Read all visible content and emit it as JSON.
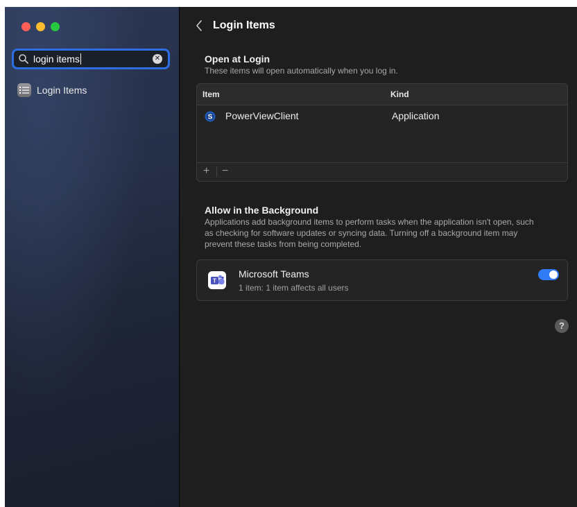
{
  "window": {
    "traffic_lights": [
      "close",
      "minimize",
      "zoom"
    ]
  },
  "sidebar": {
    "search": {
      "value": "login items",
      "icon": "magnifier-icon"
    },
    "results": [
      {
        "label": "Login Items",
        "icon": "list-icon"
      }
    ]
  },
  "header": {
    "title": "Login Items"
  },
  "open_at_login": {
    "title": "Open at Login",
    "description": "These items will open automatically when you log in.",
    "columns": [
      "Item",
      "Kind"
    ],
    "rows": [
      {
        "name": "PowerViewClient",
        "kind": "Application",
        "icon": "powerview-app-icon"
      }
    ],
    "add_label": "+",
    "remove_label": "−"
  },
  "background": {
    "title": "Allow in the Background",
    "description": "Applications add background items to perform tasks when the application isn't open, such as checking for software updates or syncing data. Turning off a background item may prevent these tasks from being completed.",
    "items": [
      {
        "name": "Microsoft Teams",
        "detail": "1 item: 1 item affects all users",
        "enabled": true,
        "icon": "microsoft-teams-icon"
      }
    ]
  },
  "help_label": "?",
  "colors": {
    "accent": "#2f7cf6",
    "search_focus": "#2d6ee3",
    "close": "#ff5f57",
    "minimize": "#febc2e",
    "zoom": "#28c840"
  }
}
